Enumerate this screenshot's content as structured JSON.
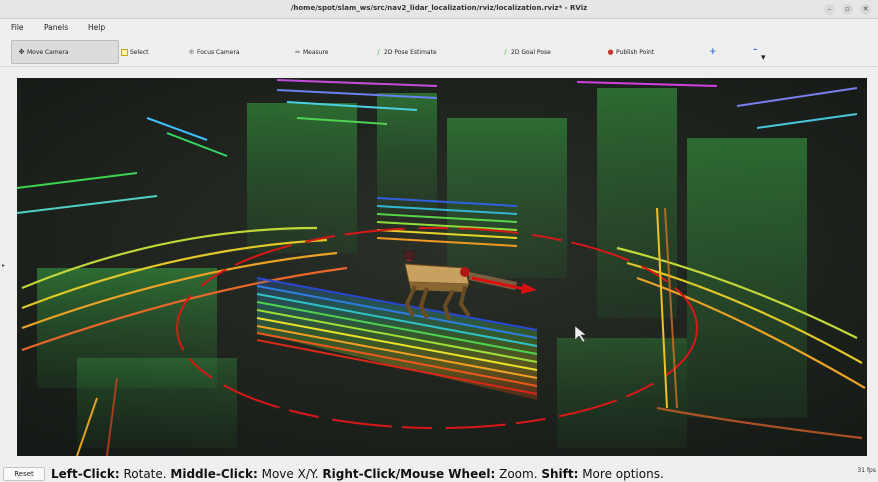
{
  "window": {
    "title": "/home/spot/slam_ws/src/nav2_lidar_localization/rviz/localization.rviz* - RViz",
    "controls": {
      "minimize": "–",
      "maximize": "▫",
      "close": "✕"
    }
  },
  "menu": {
    "file": "File",
    "panels": "Panels",
    "help": "Help"
  },
  "toolbar": {
    "move_camera": "Move Camera",
    "select": "Select",
    "focus_camera": "Focus Camera",
    "measure": "Measure",
    "pose_estimate": "2D Pose Estimate",
    "goal_pose": "2D Goal Pose",
    "publish_point": "Publish Point",
    "add_tool": "+",
    "remove_tool": "–",
    "more_tools": "▾"
  },
  "colors": {
    "viewport_bg": "#1e231e",
    "robot_body": "#c8a060",
    "arrow_red": "#d81010"
  },
  "status": {
    "reset": "Reset",
    "help_left_click": "Left-Click:",
    "help_rotate": " Rotate. ",
    "help_middle_click": "Middle-Click:",
    "help_move": " Move X/Y. ",
    "help_right_click": "Right-Click/Mouse Wheel:",
    "help_zoom": " Zoom. ",
    "help_shift": "Shift:",
    "help_more": " More options.",
    "fps": "31 fps"
  },
  "viewport_handle": "▸"
}
